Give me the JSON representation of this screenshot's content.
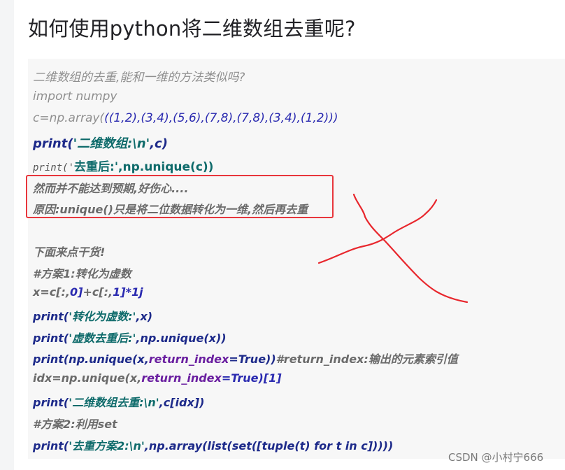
{
  "page": {
    "title": "如何使用python将二维数组去重呢?"
  },
  "code": {
    "l1": "二维数组的去重,能和一维的方法类似吗?",
    "l2": "import numpy",
    "l3a": "c=np.array(",
    "l3b": "((1,2),(3,4),(5,6),(7,8),(7,8),(3,4),(1,2)))",
    "l4a": "print(",
    "l4b": "'二维数组:\\n'",
    "l4c": ",c)",
    "l5a": "print('",
    "l5b": "去重后:'",
    "l5c": ",np.unique(c))",
    "l6": "然而并不能达到预期,好伤心....",
    "l7": "原因:unique()只是将二位数据转化为一维,然后再去重",
    "l8": "下面来点干货!",
    "l9": "#方案1:转化为虚数",
    "l10a": "x=c[:,",
    "l10b": "0]",
    "l10c": "+c[:,",
    "l10d": "1]*1j",
    "l11a": "print(",
    "l11b": "'转化为虚数:'",
    "l11c": ",x)",
    "l12a": "print(",
    "l12b": "'虚数去重后:'",
    "l12c": ",np.unique(x))",
    "l13a": "print(np.unique(x,",
    "l13b": "return_index",
    "l13c": "=True))",
    "l13d": "#return_index:输出的元素索引值",
    "l14a": "idx=np.unique(x,",
    "l14b": "return_index",
    "l14c": "=True)[1]",
    "l15a": "print(",
    "l15b": "'二维数组去重:\\n'",
    "l15c": ",c[idx])",
    "l16": "#方案2:利用set",
    "l17a": "print(",
    "l17b": "'去重方案2:\\n'",
    "l17c": ",np.array(list(set([tuple(t) for t in c]))))"
  },
  "annotation": {
    "box_color": "#e8363c",
    "mark_color": "#e8272d",
    "mark_icon": "cross-mark-icon"
  },
  "watermark": {
    "text": "CSDN @小村宁666"
  }
}
